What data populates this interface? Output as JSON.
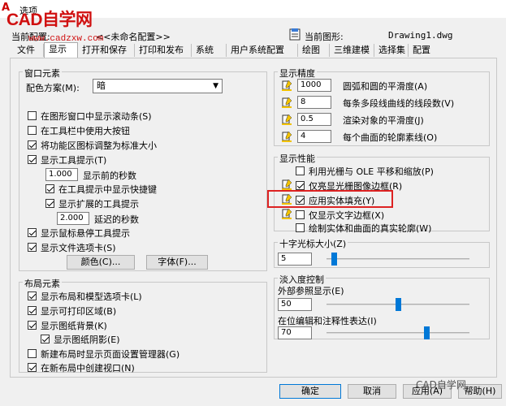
{
  "window": {
    "title": "选项",
    "app_letter": "A"
  },
  "watermark": {
    "brand": "CAD自学网",
    "url": "www.cadzxw.com",
    "footer": "CAD自学网"
  },
  "profile": {
    "label": "当前配置:",
    "value": "<<未命名配置>>"
  },
  "drawing": {
    "label": "当前图形:",
    "value": "Drawing1.dwg"
  },
  "tabs": [
    "文件",
    "显示",
    "打开和保存",
    "打印和发布",
    "系统",
    "用户系统配置",
    "绘图",
    "三维建模",
    "选择集",
    "配置"
  ],
  "window_elements": {
    "title": "窗口元素",
    "color_scheme_label": "配色方案(M):",
    "color_scheme_value": "暗",
    "scrollbars": "在图形窗口中显示滚动条(S)",
    "large_buttons": "在工具栏中使用大按钮",
    "resize_icons": "将功能区图标调整为标准大小",
    "tooltips": "显示工具提示(T)",
    "tooltip_delay_value": "1.000",
    "tooltip_delay_label": "显示前的秒数",
    "shortcut_keys": "在工具提示中显示快捷键",
    "extended_tooltips": "显示扩展的工具提示",
    "extended_delay_value": "2.000",
    "extended_delay_label": "延迟的秒数",
    "rollover": "显示鼠标悬停工具提示",
    "file_tabs": "显示文件选项卡(S)",
    "colors_button": "颜色(C)...",
    "fonts_button": "字体(F)..."
  },
  "layout_elements": {
    "title": "布局元素",
    "layout_tabs": "显示布局和模型选项卡(L)",
    "printable_area": "显示可打印区域(B)",
    "paper_background": "显示图纸背景(K)",
    "paper_shadow": "显示图纸阴影(E)",
    "page_setup": "新建布局时显示页面设置管理器(G)",
    "create_viewport": "在新布局中创建视口(N)"
  },
  "display_resolution": {
    "title": "显示精度",
    "rows": [
      {
        "value": "1000",
        "label": "圆弧和圆的平滑度(A)"
      },
      {
        "value": "8",
        "label": "每条多段线曲线的线段数(V)"
      },
      {
        "value": "0.5",
        "label": "渲染对象的平滑度(J)"
      },
      {
        "value": "4",
        "label": "每个曲面的轮廓素线(O)"
      }
    ]
  },
  "display_performance": {
    "title": "显示性能",
    "raster_pan": "利用光栅与 OLE 平移和缩放(P)",
    "highlight_frame": "仅亮显光栅图像边框(R)",
    "solid_fill": "应用实体填充(Y)",
    "text_boundary": "仅显示文字边框(X)",
    "silhouettes": "绘制实体和曲面的真实轮廓(W)"
  },
  "crosshair": {
    "title": "十字光标大小(Z)",
    "value": "5",
    "slider": 0.05
  },
  "fade": {
    "title": "淡入度控制",
    "xref_label": "外部参照显示(E)",
    "xref_value": "50",
    "xref_slider": 0.5,
    "inplace_label": "在位编辑和注释性表达(I)",
    "inplace_value": "70",
    "inplace_slider": 0.7
  },
  "buttons": {
    "ok": "确定",
    "cancel": "取消",
    "apply": "应用(A)",
    "help": "帮助(H)"
  }
}
